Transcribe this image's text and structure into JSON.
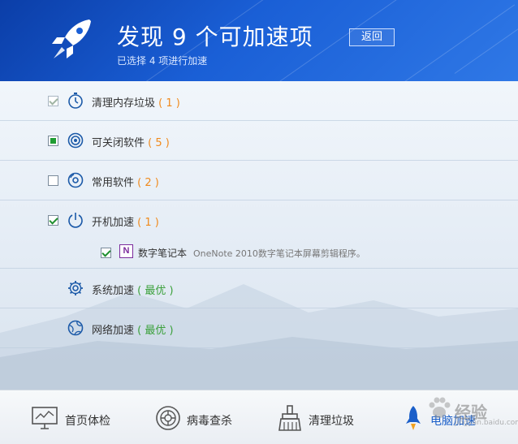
{
  "header": {
    "title": "发现 9 个可加速项",
    "subtitle": "已选择 4 项进行加速",
    "back_label": "返回"
  },
  "items": [
    {
      "label": "清理内存垃圾",
      "count": "( 1 )",
      "checkbox": "checked-disabled",
      "icon": "stopwatch-icon"
    },
    {
      "label": "可关闭软件",
      "count": "( 5 )",
      "checkbox": "partial",
      "icon": "target-icon"
    },
    {
      "label": "常用软件",
      "count": "( 2 )",
      "checkbox": "unchecked",
      "icon": "disc-icon"
    },
    {
      "label": "开机加速",
      "count": "( 1 )",
      "checkbox": "checked",
      "icon": "power-icon"
    },
    {
      "label": "系统加速",
      "count": "( 最优 )",
      "icon": "gear-icon"
    },
    {
      "label": "网络加速",
      "count": "( 最优 )",
      "icon": "globe-icon"
    }
  ],
  "subitem": {
    "app_badge": "N",
    "name": "数字笔记本",
    "desc": "OneNote 2010数字笔记本屏幕剪辑程序。",
    "checkbox": "checked"
  },
  "nav": [
    {
      "label": "首页体检",
      "icon": "monitor-icon"
    },
    {
      "label": "病毒查杀",
      "icon": "crosshair-icon"
    },
    {
      "label": "清理垃圾",
      "icon": "broom-icon"
    },
    {
      "label": "电脑加速",
      "icon": "rocket-icon",
      "active": true
    }
  ],
  "watermark": {
    "text": "经验",
    "sub": "jingyan.baidu.com"
  },
  "colors": {
    "header": "#1a5fd6",
    "orange": "#f08a1c",
    "green": "#3aa03a",
    "checkbox_green": "#1f9c33"
  }
}
